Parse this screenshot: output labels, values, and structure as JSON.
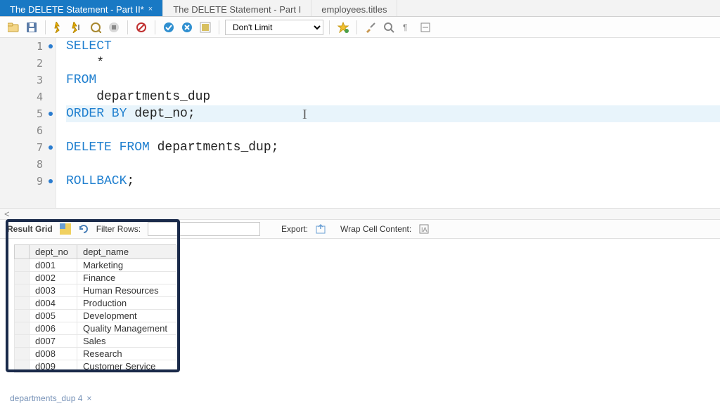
{
  "tabs": [
    {
      "label": "The DELETE Statement - Part II*",
      "active": true
    },
    {
      "label": "The DELETE Statement - Part I",
      "active": false
    },
    {
      "label": "employees.titles",
      "active": false
    }
  ],
  "toolbar": {
    "limit_label": "Don't Limit"
  },
  "editor": {
    "lines": [
      {
        "n": 1,
        "dot": true,
        "tokens": [
          [
            "kw",
            "SELECT"
          ]
        ]
      },
      {
        "n": 2,
        "dot": false,
        "tokens": [
          [
            "id",
            "    *"
          ]
        ]
      },
      {
        "n": 3,
        "dot": false,
        "tokens": [
          [
            "kw",
            "FROM"
          ]
        ]
      },
      {
        "n": 4,
        "dot": false,
        "tokens": [
          [
            "id",
            "    departments_dup"
          ]
        ]
      },
      {
        "n": 5,
        "dot": true,
        "curr": true,
        "tokens": [
          [
            "kw",
            "ORDER BY"
          ],
          [
            "id",
            " dept_no;"
          ]
        ]
      },
      {
        "n": 6,
        "dot": false,
        "tokens": []
      },
      {
        "n": 7,
        "dot": true,
        "tokens": [
          [
            "kw",
            "DELETE FROM"
          ],
          [
            "id",
            " departments_dup;"
          ]
        ]
      },
      {
        "n": 8,
        "dot": false,
        "tokens": []
      },
      {
        "n": 9,
        "dot": true,
        "tokens": [
          [
            "kw",
            "ROLLBACK"
          ],
          [
            "id",
            ";"
          ]
        ]
      }
    ]
  },
  "result_bar": {
    "grid_label": "Result Grid",
    "filter_label": "Filter Rows:",
    "export_label": "Export:",
    "wrap_label": "Wrap Cell Content:"
  },
  "grid": {
    "columns": [
      "dept_no",
      "dept_name"
    ],
    "rows": [
      [
        "d001",
        "Marketing"
      ],
      [
        "d002",
        "Finance"
      ],
      [
        "d003",
        "Human Resources"
      ],
      [
        "d004",
        "Production"
      ],
      [
        "d005",
        "Development"
      ],
      [
        "d006",
        "Quality Management"
      ],
      [
        "d007",
        "Sales"
      ],
      [
        "d008",
        "Research"
      ],
      [
        "d009",
        "Customer Service"
      ]
    ]
  },
  "bottom_tab": {
    "label": "departments_dup 4"
  }
}
